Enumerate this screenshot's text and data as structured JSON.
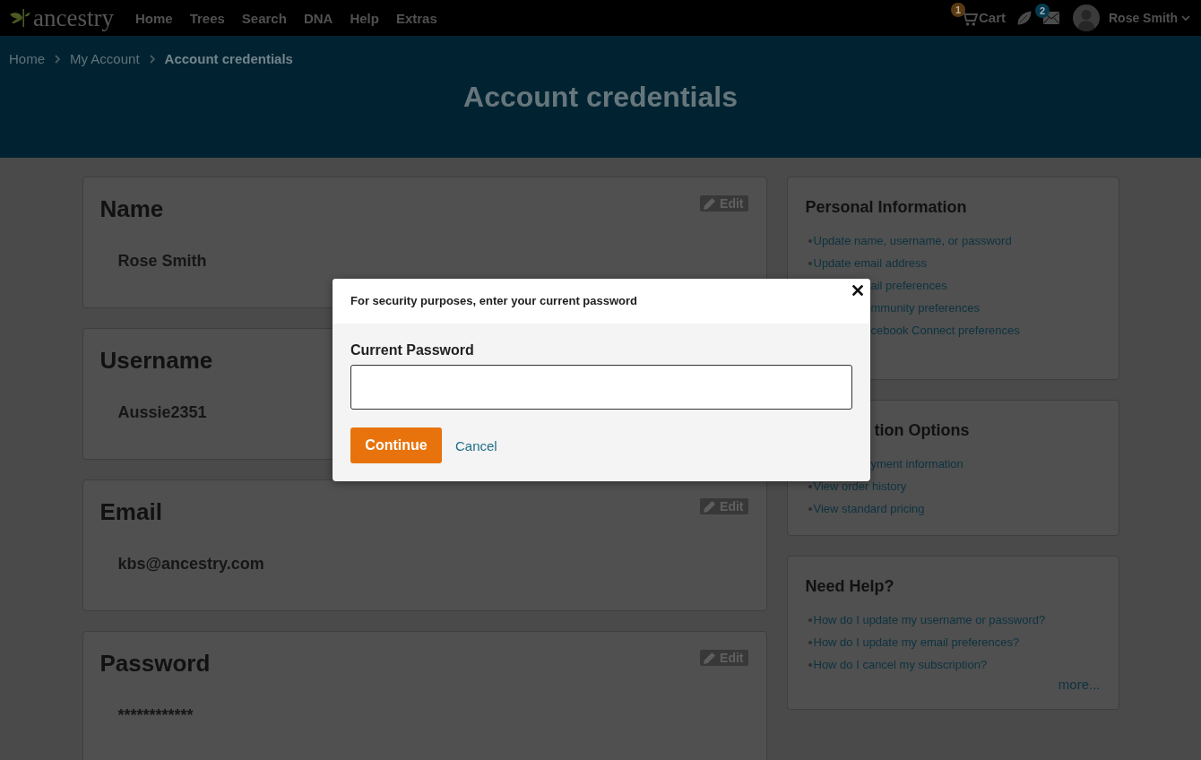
{
  "nav": {
    "logo": "ancestry",
    "items": [
      "Home",
      "Trees",
      "Search",
      "DNA",
      "Help",
      "Extras"
    ],
    "cart": {
      "label": "Cart",
      "badge": "1"
    },
    "messages": {
      "badge": "2"
    },
    "user": {
      "name": "Rose Smith"
    }
  },
  "breadcrumb": [
    {
      "label": "Home",
      "current": false
    },
    {
      "label": "My Account",
      "current": false
    },
    {
      "label": "Account credentials",
      "current": true
    }
  ],
  "page_title": "Account credentials",
  "cards": [
    {
      "title": "Name",
      "value": "Rose Smith",
      "edit": "Edit"
    },
    {
      "title": "Username",
      "value": "Aussie2351"
    },
    {
      "title": "Email",
      "value": "kbs@ancestry.com",
      "edit": "Edit"
    },
    {
      "title": "Password",
      "value": "************",
      "edit": "Edit"
    }
  ],
  "sidebar": [
    {
      "title": {
        "text": "Personal Information",
        "kind": "whole"
      },
      "links": [
        {
          "text": "Update name, username, or password",
          "kind": "whole"
        },
        {
          "text": "Update email address",
          "kind": "whole"
        },
        {
          "text": "ail preferences",
          "kind": "partial"
        },
        {
          "text": "mmunity preferences",
          "kind": "partial"
        },
        {
          "text": "cebook Connect preferences",
          "kind": "partial"
        }
      ]
    },
    {
      "title": {
        "text": "tion Options",
        "kind": "partial"
      },
      "links": [
        {
          "text": "yment information",
          "kind": "partial"
        },
        {
          "text": "View order history",
          "kind": "whole"
        },
        {
          "text": "View standard pricing",
          "kind": "whole"
        }
      ]
    },
    {
      "title": {
        "text": "Need Help?",
        "kind": "whole"
      },
      "links": [
        {
          "text": "How do I update my username or password?",
          "kind": "whole"
        },
        {
          "text": "How do I update my email preferences?",
          "kind": "whole"
        },
        {
          "text": "How do I cancel my subscription?",
          "kind": "whole"
        }
      ],
      "more": "more..."
    }
  ],
  "dialog": {
    "title": "For security purposes, enter your current password",
    "field_label": "Current Password",
    "continue": "Continue",
    "cancel": "Cancel"
  }
}
